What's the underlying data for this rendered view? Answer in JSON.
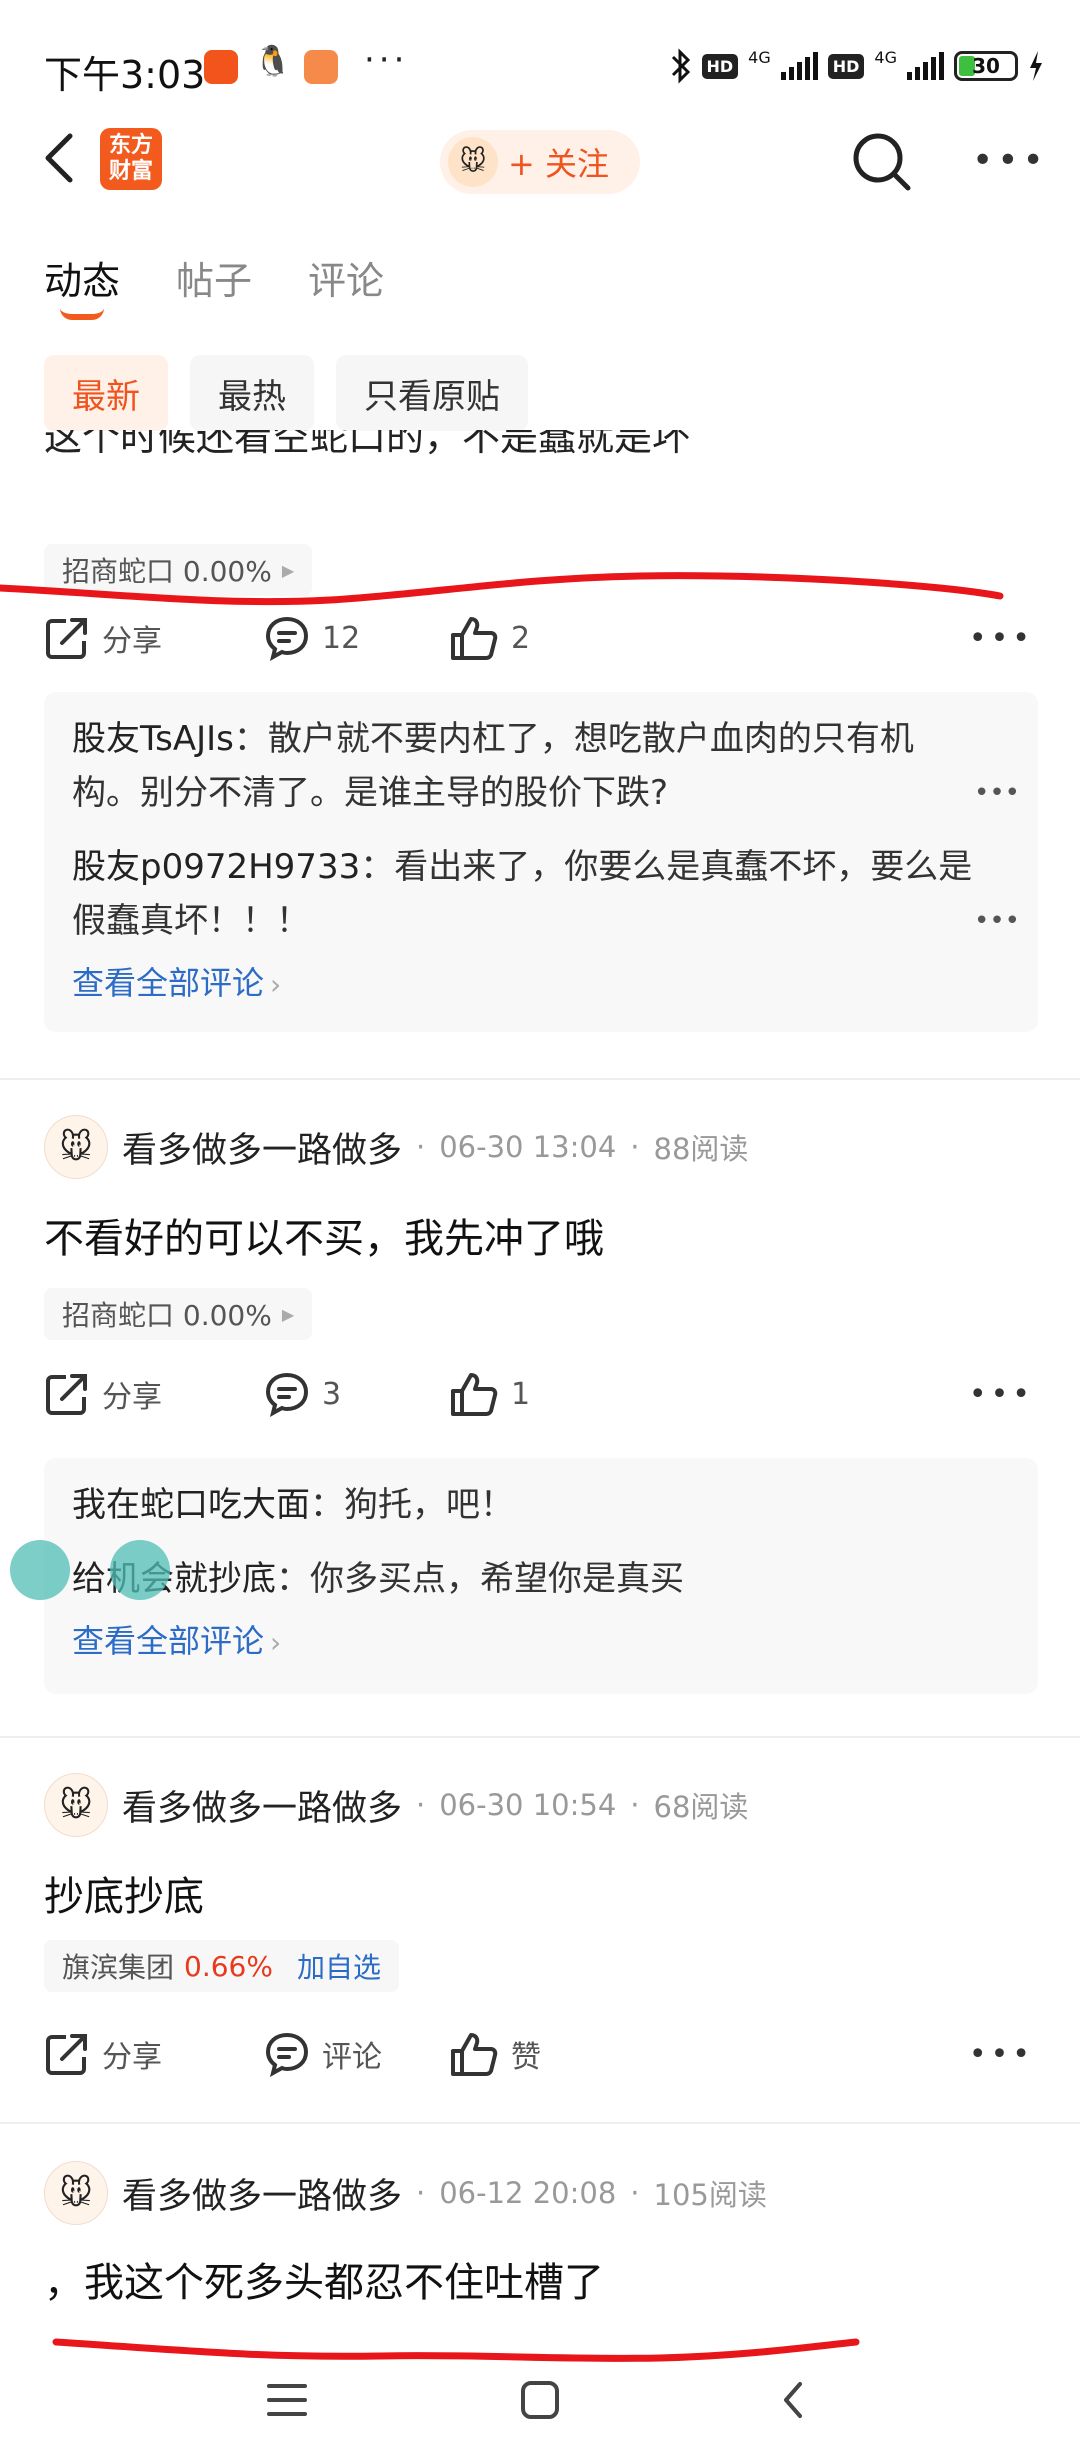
{
  "status_bar": {
    "time": "下午3:03",
    "more": "···",
    "net1": "4G",
    "net2": "4G",
    "hd": "HD",
    "battery": "30"
  },
  "nav": {
    "app_logo_text": "东方财富",
    "follow_label": "+ 关注"
  },
  "tabs": [
    {
      "label": "动态",
      "active": true
    },
    {
      "label": "帖子",
      "active": false
    },
    {
      "label": "评论",
      "active": false
    }
  ],
  "filters": [
    {
      "label": "最新",
      "active": true
    },
    {
      "label": "最热",
      "active": false
    },
    {
      "label": "只看原贴",
      "active": false
    }
  ],
  "post1": {
    "partial_text": "这个时候还看空蛇口的，不是蠢就是坏",
    "stock": "招商蛇口 0.00%",
    "share": "分享",
    "comments": "12",
    "likes": "2",
    "replies": [
      {
        "author": "股友TsAJIs",
        "text": "：散户就不要内杠了，想吃散户血肉的只有机构。别分不清了。是谁主导的股价下跌?"
      },
      {
        "author": "股友p0972H9733",
        "text": "：看出来了，你要么是真蠢不坏，要么是假蠢真坏！！！"
      }
    ],
    "view_all": "查看全部评论"
  },
  "post2": {
    "user": "看多做多一路做多",
    "date": "06-30 13:04",
    "reads": "88阅读",
    "body": "不看好的可以不买，我先冲了哦",
    "stock": "招商蛇口 0.00%",
    "share": "分享",
    "comments": "3",
    "likes": "1",
    "replies": [
      {
        "author": "我在蛇口吃大面",
        "text": "：狗托，吧！"
      },
      {
        "author": "给机会就抄底",
        "text": "：你多买点，希望你是真买"
      }
    ],
    "view_all": "查看全部评论"
  },
  "post3": {
    "user": "看多做多一路做多",
    "date": "06-30 10:54",
    "reads": "68阅读",
    "body": "抄底抄底",
    "stock_name": "旗滨集团",
    "stock_pct": "0.66%",
    "add_watch": "加自选",
    "share": "分享",
    "comment": "评论",
    "like": "赞"
  },
  "post4": {
    "user": "看多做多一路做多",
    "date": "06-12 20:08",
    "reads": "105阅读",
    "body": "，我这个死多头都忍不住吐槽了"
  },
  "colors": {
    "accent": "#f35a1e",
    "link": "#2d6cc6",
    "annotation": "#e8161a"
  }
}
